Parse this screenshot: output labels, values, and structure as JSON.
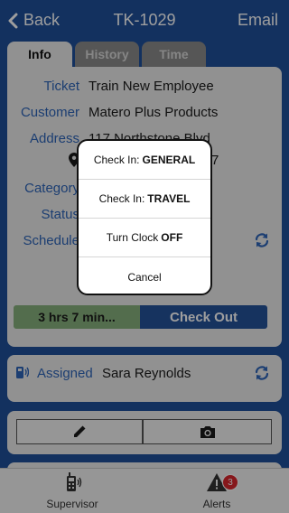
{
  "nav": {
    "back_label": "Back",
    "title": "TK-1029",
    "email_label": "Email"
  },
  "tabs": [
    {
      "label": "Info"
    },
    {
      "label": "History"
    },
    {
      "label": "Time"
    }
  ],
  "details": {
    "ticket_label": "Ticket",
    "ticket_value": "Train New Employee",
    "customer_label": "Customer",
    "customer_value": "Matero Plus Products",
    "address_label": "Address",
    "address_line1": "117 Northstone Blvd",
    "address_line2_suffix": "7",
    "category_label": "Category",
    "status_label": "Status",
    "schedule_label": "Schedule"
  },
  "time_status": {
    "elapsed": "3 hrs 7 min...",
    "checkout_label": "Check Out"
  },
  "assigned": {
    "label": "Assigned",
    "name": "Sara Reynolds"
  },
  "toolbar": {
    "supervisor_label": "Supervisor",
    "alerts_label": "Alerts",
    "alerts_count": "3"
  },
  "popup": {
    "options": [
      {
        "prefix": "Check In:",
        "emphasis": "GENERAL"
      },
      {
        "prefix": "Check In:",
        "emphasis": "TRAVEL"
      },
      {
        "prefix": "Turn Clock",
        "emphasis": "OFF"
      },
      {
        "prefix": "Cancel",
        "emphasis": ""
      }
    ]
  },
  "colors": {
    "header_blue": "#1f4f9a",
    "label_blue": "#2e65b8",
    "timer_green": "#86b07c",
    "checkout_blue": "#25539a",
    "badge_red": "#d8262c"
  },
  "icons": [
    "chevron-left-icon",
    "map-pin-icon",
    "refresh-icon",
    "radio-id-icon",
    "pencil-icon",
    "camera-icon",
    "walkie-talkie-icon",
    "alert-triangle-icon"
  ]
}
